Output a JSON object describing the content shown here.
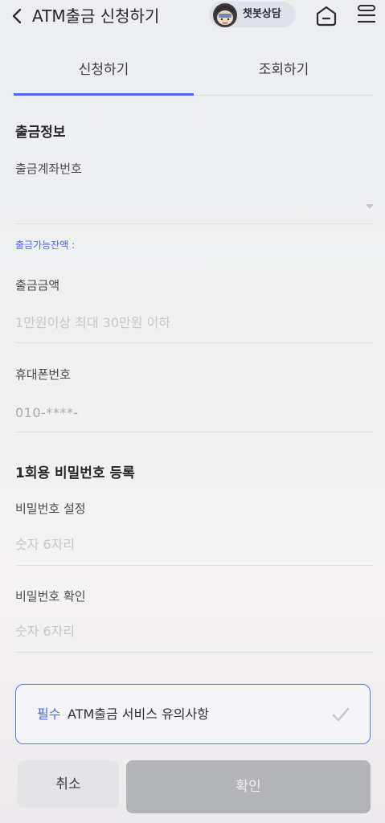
{
  "header": {
    "title": "ATM출금 신청하기",
    "chatbot_label": "챗봇상담",
    "icons": [
      "back-arrow-icon",
      "chatbot-avatar-icon",
      "home-icon",
      "menu-icon"
    ]
  },
  "tabs": [
    {
      "label": "신청하기",
      "active": true
    },
    {
      "label": "조회하기",
      "active": false
    }
  ],
  "withdrawal_info": {
    "section_title": "출금정보",
    "account_label": "출금계좌번호",
    "account_value": "",
    "balance_label": "출금가능잔액 :",
    "amount_label": "출금금액",
    "amount_placeholder": "1만원이상 최대 30만원 이하",
    "phone_label": "휴대폰번호",
    "phone_value": "010-****-"
  },
  "otp": {
    "section_title": "1회용 비밀번호 등록",
    "password_label": "비밀번호 설정",
    "password_placeholder": "숫자 6자리",
    "confirm_label": "비밀번호 확인",
    "confirm_placeholder": "숫자 6자리"
  },
  "notice": {
    "required_label": "필수",
    "text": "ATM출금 서비스 유의사항"
  },
  "buttons": {
    "cancel": "취소",
    "confirm": "확인"
  },
  "colors": {
    "accent": "#4e68f0",
    "confirm_disabled": "#b3b4b8",
    "cancel_bg": "#e4e4e7"
  }
}
